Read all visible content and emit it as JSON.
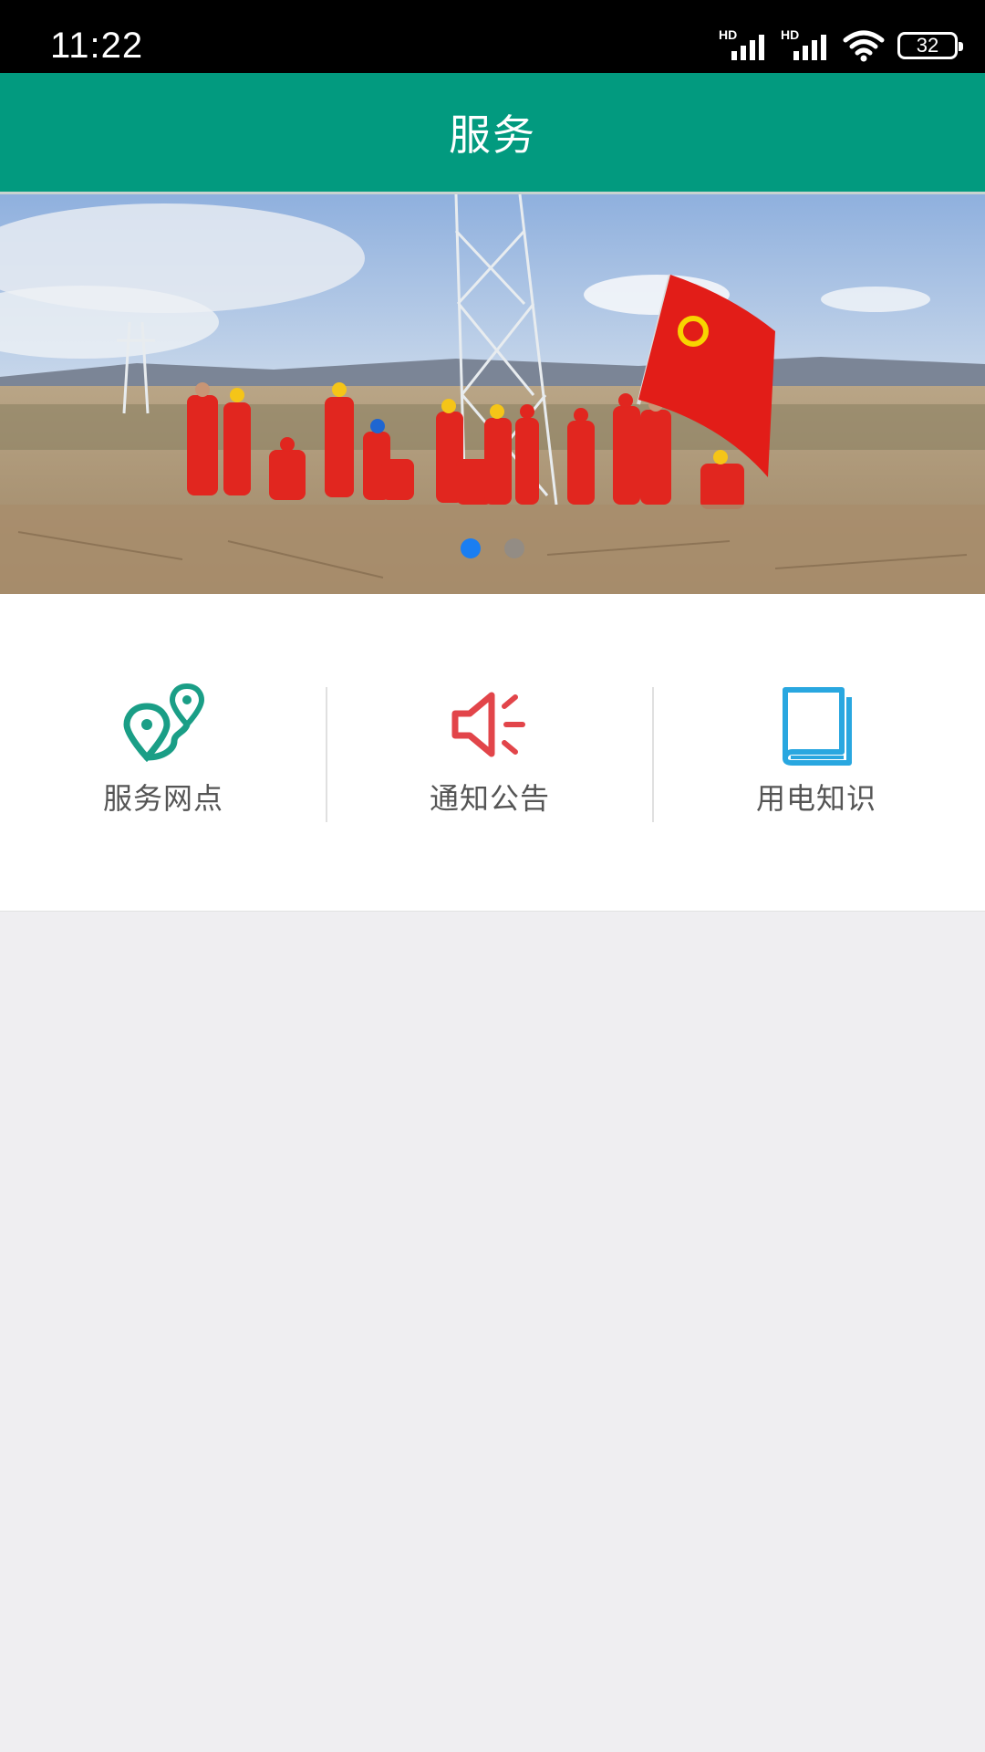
{
  "status_bar": {
    "time": "11:22",
    "signal1_label": "HD",
    "signal2_label": "HD",
    "battery": "32"
  },
  "header": {
    "title": "服务"
  },
  "banner": {
    "slides": 2,
    "active_slide": 1
  },
  "services": [
    {
      "label": "服务网点",
      "icon": "map-route-pin-icon",
      "color": "#1a9e86"
    },
    {
      "label": "通知公告",
      "icon": "megaphone-icon",
      "color": "#e2454a"
    },
    {
      "label": "用电知识",
      "icon": "book-icon",
      "color": "#29a7e0"
    }
  ],
  "colors": {
    "header_bg": "#029a7f",
    "page_bg": "#efeef1",
    "dot_active": "#1a7ef2"
  }
}
